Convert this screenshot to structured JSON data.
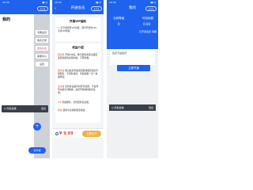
{
  "left": {
    "status_time": "19:34",
    "title": "",
    "drawer_heading": "我的",
    "side_tags": [
      "专属会员",
      "购买记录",
      "邀请好友",
      "客服中心",
      "设置"
    ],
    "bottom_left": "◎ 隐私政策",
    "bottom_right": "退出",
    "fab_icon": "+",
    "pill_label": "去升级"
  },
  "center": {
    "status_time": "19:30",
    "title": "开通会员",
    "back_icon": "‹",
    "capsule": "•••",
    "heading": "开通VIP福利",
    "benefit_line": "1. 可享受所有VIP功能，即可开通为VIP，享受VIP特权",
    "section_heading": "权益介绍",
    "items": [
      {
        "tag": "更优质",
        "text": "开通VIP后，畅享更优质更全面更多更优质的资源内容，不限次数。"
      },
      {
        "tag": "超快速",
        "text": "通过会员专属通道更快更稳定的享受服务，不排队等待，专属客服一对一快速响应。"
      },
      {
        "tag": "多设备",
        "text": "支持多设备同时登录使用，平台所有内容全部解锁，会员有效期内随意使用。"
      },
      {
        "tag": "VIP",
        "text": "专属图标，身份更尊贵显眼。"
      },
      {
        "tag": "其他",
        "text": "其他平台福利更多权益。"
      }
    ],
    "price": "¥ 9.99",
    "pay_label": "立即支付"
  },
  "right": {
    "status_time": "19:34",
    "title": "我的",
    "hero_left_label": "当前等级",
    "hero_left_value": "0",
    "hero_right_label": "可用余额",
    "hero_right_value": "0.00",
    "hero_note": "已开通会员 到期",
    "card_text": "您还不是会员",
    "button_label": "立即开通",
    "bottom_left": "◎ 隐私政策",
    "bottom_right": "退出"
  },
  "colors": {
    "brand_blue": "#1f62ee",
    "accent_red": "#e8473b",
    "pay_orange": "#f1b142"
  }
}
